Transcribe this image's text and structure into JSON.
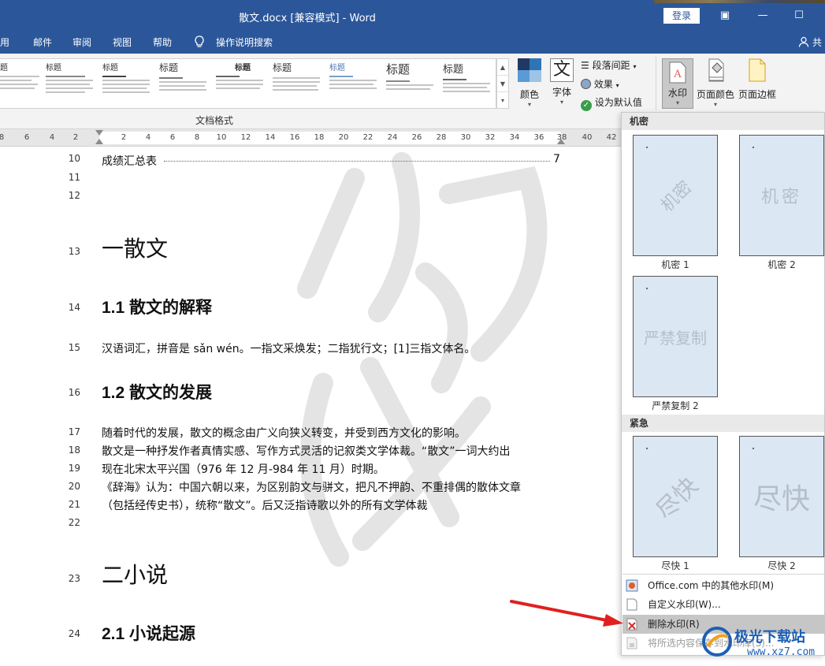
{
  "titlebar": {
    "title": "散文.docx [兼容模式]  -  Word",
    "login": "登录"
  },
  "menubar": {
    "items": [
      "用",
      "邮件",
      "审阅",
      "视图",
      "帮助",
      "操作说明搜索"
    ],
    "share": "共"
  },
  "ribbon": {
    "style_tiles": [
      {
        "heading": "题"
      },
      {
        "heading": "标题"
      },
      {
        "heading": "标题"
      },
      {
        "heading": "标题"
      },
      {
        "heading": "标题"
      },
      {
        "heading": "标题"
      },
      {
        "heading": "标题"
      },
      {
        "heading": "标题"
      },
      {
        "heading": "标题"
      }
    ],
    "group_label": "文档格式",
    "colors_label": "颜色",
    "fonts_label": "字体",
    "fonts_glyph": "文",
    "paragraph_spacing": "段落间距",
    "effects": "效果",
    "set_default": "设为默认值",
    "watermark": "水印",
    "page_color": "页面颜色",
    "page_border": "页面边框"
  },
  "ruler": {
    "ticks": [
      "8",
      "6",
      "4",
      "2",
      "",
      "2",
      "4",
      "6",
      "8",
      "10",
      "12",
      "14",
      "16",
      "18",
      "20",
      "22",
      "24",
      "26",
      "28",
      "30",
      "32",
      "34",
      "36",
      "38",
      "40",
      "42"
    ]
  },
  "document": {
    "lines": [
      {
        "num": "10",
        "text": "成绩汇总表",
        "suffix": "7",
        "style": "toc"
      },
      {
        "num": "11",
        "text": "",
        "style": "body"
      },
      {
        "num": "12",
        "text": "",
        "style": "body"
      },
      {
        "num": "13",
        "text": "一散文",
        "style": "h1"
      },
      {
        "num": "14",
        "text": "1.1 散文的解释",
        "style": "h2"
      },
      {
        "num": "15",
        "text": "汉语词汇，拼音是 sǎn wén。一指文采焕发；二指犹行文；[1]三指文体名。",
        "style": "body"
      },
      {
        "num": "16",
        "text": "1.2 散文的发展",
        "style": "h2"
      },
      {
        "num": "17",
        "text": "随着时代的发展，散文的概念由广义向狭义转变，并受到西方文化的影响。",
        "style": "body"
      },
      {
        "num": "18",
        "text": "散文是一种抒发作者真情实感、写作方式灵活的记叙类文学体裁。“散文”一词大约出",
        "style": "body"
      },
      {
        "num": "19",
        "text": "现在北宋太平兴国（976 年 12 月-984 年 11 月）时期。",
        "style": "body"
      },
      {
        "num": "20",
        "text": "《辞海》认为：中国六朝以来，为区别韵文与骈文，把凡不押韵、不重排偶的散体文章",
        "style": "body"
      },
      {
        "num": "21",
        "text": "（包括经传史书），统称“散文”。后又泛指诗歌以外的所有文学体裁",
        "style": "body"
      },
      {
        "num": "22",
        "text": "",
        "style": "body"
      },
      {
        "num": "23",
        "text": "二小说",
        "style": "h1"
      },
      {
        "num": "24",
        "text": "2.1 小说起源",
        "style": "h2"
      }
    ]
  },
  "watermark_panel": {
    "sections": [
      {
        "title": "机密",
        "items": [
          {
            "label": "机密 1",
            "text": "机密",
            "variant": "diagonal"
          },
          {
            "label": "机密 2",
            "text": "机密",
            "variant": "horizontal"
          },
          {
            "label": "严禁复制 2",
            "text": "严禁复制",
            "variant": "horizontal"
          }
        ]
      },
      {
        "title": "紧急",
        "items": [
          {
            "label": "尽快 1",
            "text": "尽快",
            "variant": "diagonal"
          },
          {
            "label": "尽快 2",
            "text": "尽快",
            "variant": "horizontal"
          }
        ]
      }
    ],
    "menu": [
      {
        "label": "Office.com 中的其他水印(M)",
        "state": "normal"
      },
      {
        "label": "自定义水印(W)...",
        "state": "normal"
      },
      {
        "label": "删除水印(R)",
        "state": "highlighted"
      },
      {
        "label": "将所选内容保存到水印库(S)...",
        "state": "disabled"
      }
    ]
  },
  "brand": {
    "name": "极光下载站",
    "url": "www.xz7.com"
  },
  "colors": {
    "title_bar": "#2b579a",
    "arrow": "#e02020",
    "watermark_tile": "#dbe7f3"
  }
}
